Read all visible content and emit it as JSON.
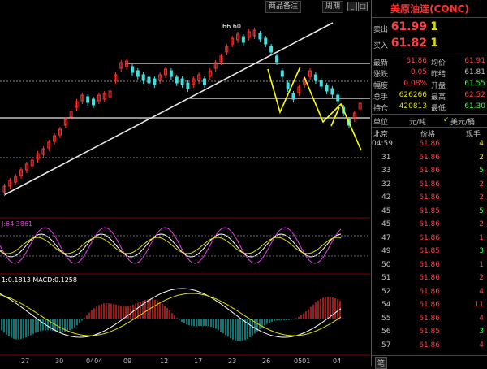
{
  "toolbar": {
    "btn1": "商品备注",
    "btn2": "周期",
    "min": "_",
    "max": "□",
    "close": "×"
  },
  "chart": {
    "peak_label": "66.60",
    "kdj_label": "J:64.3861",
    "macd_label": "1:0.1813  MACD:0.1258",
    "x_labels": [
      "27",
      "30",
      "0404",
      "09",
      "12",
      "17",
      "23",
      "26",
      "0501",
      "04"
    ]
  },
  "panel": {
    "title": "美原油连(CONC)",
    "sell_label": "卖出",
    "sell_price": "61.99",
    "sell_qty": "1",
    "buy_label": "买入",
    "buy_price": "61.82",
    "buy_qty": "1",
    "stats": [
      {
        "l1": "最新",
        "v1": "61.86",
        "c1": "#ff4040",
        "l2": "均价",
        "v2": "61.91",
        "c2": "#ff4040"
      },
      {
        "l1": "涨跌",
        "v1": "0.05",
        "c1": "#ff4040",
        "l2": "昨结",
        "v2": "61.81",
        "c2": "#c0c0c0"
      },
      {
        "l1": "幅度",
        "v1": "0.08%",
        "c1": "#ff4040",
        "l2": "开盘",
        "v2": "61.55",
        "c2": "#30ff30"
      },
      {
        "l1": "总手",
        "v1": "626266",
        "c1": "#e0e000",
        "l2": "最高",
        "v2": "62.52",
        "c2": "#ff4040"
      },
      {
        "l1": "持仓",
        "v1": "420813",
        "c1": "#e0e000",
        "l2": "最低",
        "v2": "61.30",
        "c2": "#30ff30"
      }
    ],
    "unit_label": "单位",
    "unit_val1": "元/吨",
    "unit_val2": "美元/桶",
    "head_location": "北京",
    "head_price": "价格",
    "head_vol": "现手",
    "ticks": [
      {
        "t": "04:59",
        "p": "61.86",
        "v": "4",
        "c": "#e0e000"
      },
      {
        "t": "31",
        "p": "61.86",
        "v": "2",
        "c": "#e0e000"
      },
      {
        "t": "33",
        "p": "61.86",
        "v": "5",
        "c": "#30ff30"
      },
      {
        "t": "32",
        "p": "61.86",
        "v": "2",
        "c": "#ff4040"
      },
      {
        "t": "42",
        "p": "61.86",
        "v": "2",
        "c": "#ff4040"
      },
      {
        "t": "45",
        "p": "61.85",
        "v": "5",
        "c": "#30ff30"
      },
      {
        "t": "45",
        "p": "61.86",
        "v": "2",
        "c": "#ff4040"
      },
      {
        "t": "47",
        "p": "61.86",
        "v": "1",
        "c": "#ff4040"
      },
      {
        "t": "49",
        "p": "61.85",
        "v": "3",
        "c": "#30ff30"
      },
      {
        "t": "50",
        "p": "61.86",
        "v": "1",
        "c": "#ff4040"
      },
      {
        "t": "51",
        "p": "61.86",
        "v": "2",
        "c": "#ff4040"
      },
      {
        "t": "52",
        "p": "61.86",
        "v": "4",
        "c": "#ff4040"
      },
      {
        "t": "54",
        "p": "61.86",
        "v": "11",
        "c": "#ff4040"
      },
      {
        "t": "55",
        "p": "61.86",
        "v": "4",
        "c": "#ff4040"
      },
      {
        "t": "56",
        "p": "61.85",
        "v": "3",
        "c": "#30ff30"
      },
      {
        "t": "57",
        "p": "61.86",
        "v": "4",
        "c": "#ff4040"
      }
    ],
    "footer_tab": "笔"
  }
}
